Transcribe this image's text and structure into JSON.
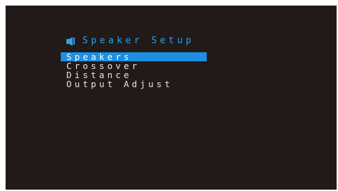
{
  "menu": {
    "title": "Speaker Setup",
    "title_icon": "speaker-setup-icon",
    "items": [
      {
        "label": "Speakers",
        "selected": true
      },
      {
        "label": "Crossover",
        "selected": false
      },
      {
        "label": "Distance",
        "selected": false
      },
      {
        "label": "Output Adjust",
        "selected": false
      }
    ]
  },
  "colors": {
    "screen_background": "#221a18",
    "accent": "#2aa3e6",
    "highlight": "#1e8fe0",
    "text": "#e6e6e6"
  }
}
